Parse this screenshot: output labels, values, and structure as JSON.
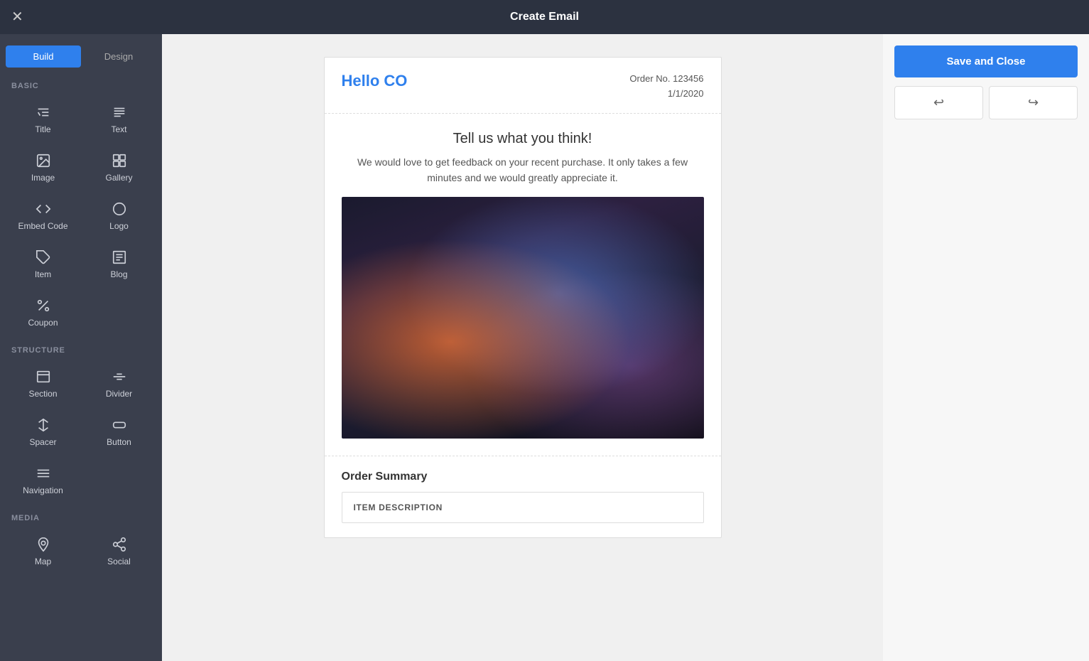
{
  "topbar": {
    "title": "Create Email",
    "close_icon": "×"
  },
  "tabs": {
    "build_label": "Build",
    "design_label": "Design"
  },
  "sidebar": {
    "basic_label": "BASIC",
    "structure_label": "STRUCTURE",
    "media_label": "MEDIA",
    "basic_items": [
      {
        "id": "title",
        "label": "Title"
      },
      {
        "id": "text",
        "label": "Text"
      },
      {
        "id": "image",
        "label": "Image"
      },
      {
        "id": "gallery",
        "label": "Gallery"
      },
      {
        "id": "embed-code",
        "label": "Embed Code"
      },
      {
        "id": "logo",
        "label": "Logo"
      },
      {
        "id": "item",
        "label": "Item"
      },
      {
        "id": "blog",
        "label": "Blog"
      },
      {
        "id": "coupon",
        "label": "Coupon"
      }
    ],
    "structure_items": [
      {
        "id": "section",
        "label": "Section"
      },
      {
        "id": "divider",
        "label": "Divider"
      },
      {
        "id": "spacer",
        "label": "Spacer"
      },
      {
        "id": "button",
        "label": "Button"
      },
      {
        "id": "navigation",
        "label": "Navigation"
      }
    ],
    "media_items": [
      {
        "id": "map",
        "label": "Map"
      },
      {
        "id": "social",
        "label": "Social"
      }
    ]
  },
  "email": {
    "greeting": "Hello CO",
    "order_number_label": "Order No. 123456",
    "order_date": "1/1/2020",
    "section_title": "Tell us what you think!",
    "section_body": "We would love to get feedback on your recent purchase. It only takes a few minutes and we would greatly appreciate it.",
    "order_summary_label": "Order Summary",
    "item_description_label": "ITEM DESCRIPTION"
  },
  "toolbar": {
    "save_label": "Save and Close"
  }
}
